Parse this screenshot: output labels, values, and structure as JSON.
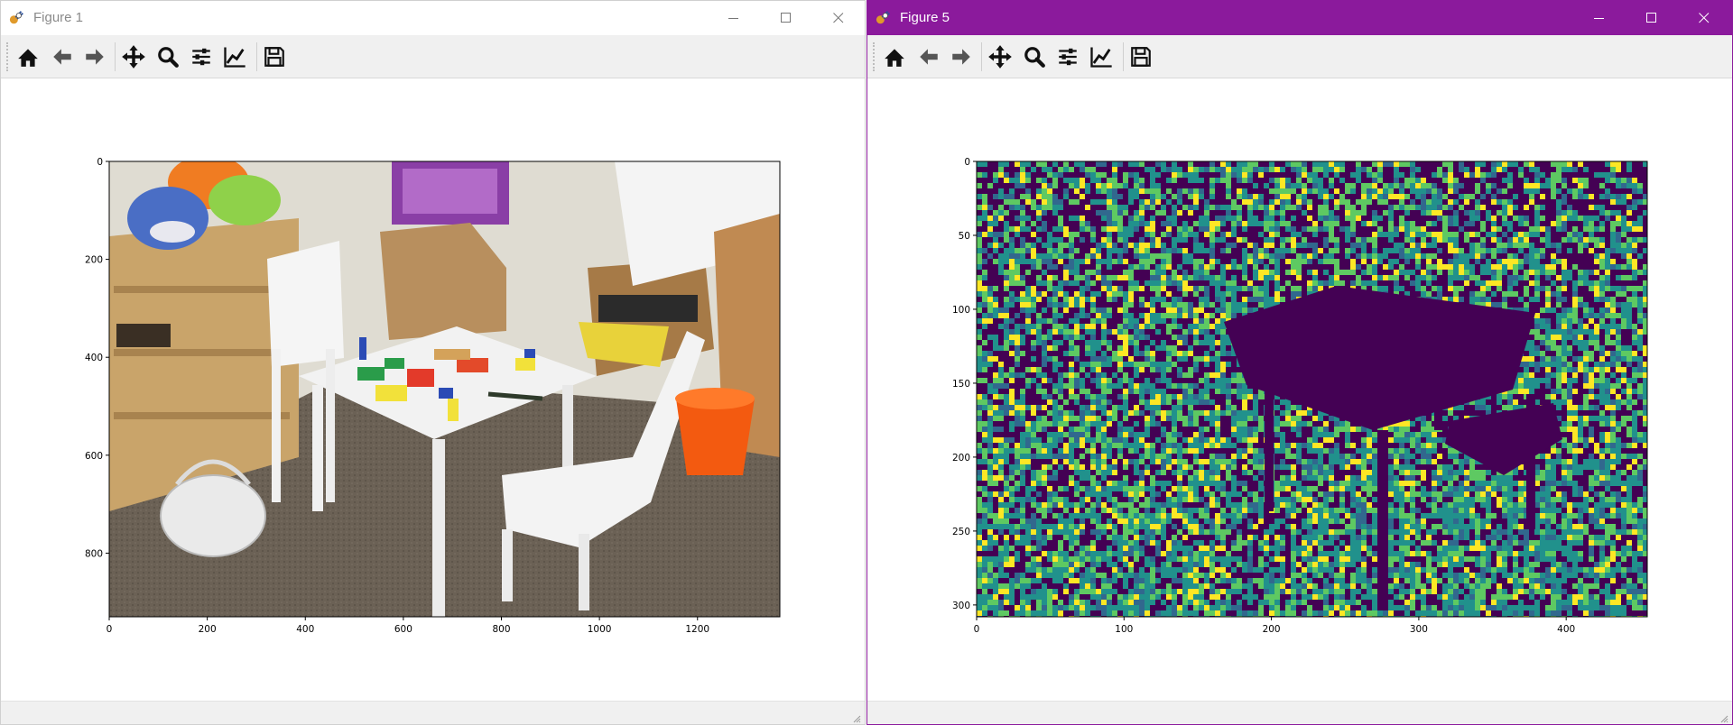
{
  "windows": [
    {
      "title": "Figure 1",
      "chart": {
        "type": "image",
        "xticks": [
          "0",
          "200",
          "400",
          "600",
          "800",
          "1000",
          "1200"
        ],
        "yticks": [
          "0",
          "200",
          "400",
          "600",
          "800"
        ],
        "xlim": [
          0,
          1368
        ],
        "ylim": [
          0,
          930
        ]
      }
    },
    {
      "title": "Figure 5",
      "chart": {
        "type": "heatmap",
        "colormap": "viridis",
        "xticks": [
          "0",
          "100",
          "200",
          "300",
          "400"
        ],
        "yticks": [
          "0",
          "50",
          "100",
          "150",
          "200",
          "250",
          "300"
        ],
        "xlim": [
          0,
          455
        ],
        "ylim": [
          0,
          308
        ]
      }
    }
  ],
  "toolbar": {
    "buttons": [
      "home-icon",
      "back-arrow-icon",
      "forward-arrow-icon",
      "pan-icon",
      "zoom-icon",
      "configure-subplots-icon",
      "edit-axis-icon",
      "save-icon"
    ]
  },
  "colors": {
    "figure5_titlebar": "#8b1a9c",
    "toolbar_bg": "#f0f0f0",
    "viridis_dark": "#440154",
    "viridis_teal": "#21918c",
    "viridis_green": "#5ec962",
    "viridis_yellow": "#fde725"
  }
}
